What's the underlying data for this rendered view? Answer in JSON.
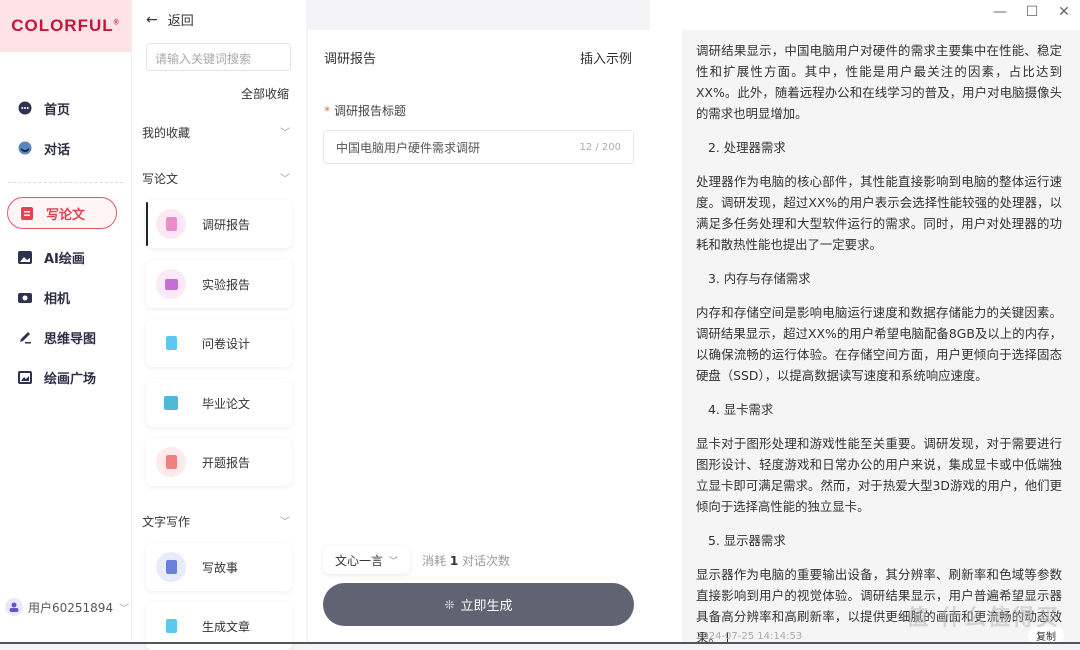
{
  "brand": {
    "logo": "COLORFUL",
    "accent": "#c2173a"
  },
  "nav": {
    "items": [
      {
        "label": "首页",
        "icon": "chat-bubble-icon"
      },
      {
        "label": "对话",
        "icon": "robot-icon"
      },
      {
        "label": "写论文",
        "icon": "document-icon",
        "active": true
      },
      {
        "label": "AI绘画",
        "icon": "image-icon"
      },
      {
        "label": "相机",
        "icon": "camera-icon"
      },
      {
        "label": "思维导图",
        "icon": "pen-icon"
      },
      {
        "label": "绘画广场",
        "icon": "gallery-icon"
      }
    ],
    "user": "用户60251894"
  },
  "templates": {
    "back": "返回",
    "search_placeholder": "请输入关键词搜索",
    "collapse_all": "全部收缩",
    "groups": [
      {
        "title": "我的收藏"
      },
      {
        "title": "写论文",
        "cards": [
          "调研报告",
          "实验报告",
          "问卷设计",
          "毕业论文",
          "开题报告"
        ]
      },
      {
        "title": "文字写作",
        "cards": [
          "写故事",
          "生成文章"
        ]
      }
    ]
  },
  "form": {
    "title": "调研报告",
    "insert_example": "插入示例",
    "field_label": "调研报告标题",
    "field_value": "中国电脑用户硬件需求调研",
    "field_count": "12 / 200",
    "model": "文心一言",
    "cost_prefix": "消耗",
    "cost_num": "1",
    "cost_suffix": "对话次数",
    "generate": "立即生成"
  },
  "output": {
    "p1": "调研结果显示，中国电脑用户对硬件的需求主要集中在性能、稳定性和扩展性方面。其中，性能是用户最关注的因素，占比达到XX%。此外，随着远程办公和在线学习的普及，用户对电脑摄像头的需求也明显增加。",
    "h2": "2. 处理器需求",
    "p2": "处理器作为电脑的核心部件，其性能直接影响到电脑的整体运行速度。调研发现，超过XX%的用户表示会选择性能较强的处理器，以满足多任务处理和大型软件运行的需求。同时，用户对处理器的功耗和散热性能也提出了一定要求。",
    "h3": "3. 内存与存储需求",
    "p3": "内存和存储空间是影响电脑运行速度和数据存储能力的关键因素。调研结果显示，超过XX%的用户希望电脑配备8GB及以上的内存，以确保流畅的运行体验。在存储空间方面，用户更倾向于选择固态硬盘（SSD），以提高数据读写速度和系统响应速度。",
    "h4": "4. 显卡需求",
    "p4": "显卡对于图形处理和游戏性能至关重要。调研发现，对于需要进行图形设计、轻度游戏和日常办公的用户来说，集成显卡或中低端独立显卡即可满足需求。然而，对于热爱大型3D游戏的用户，他们更倾向于选择高性能的独立显卡。",
    "h5": "5. 显示器需求",
    "p5": "显示器作为电脑的重要输出设备，其分辨率、刷新率和色域等参数直接影响到用户的视觉体验。调研结果显示，用户普遍希望显示器具备高分辨率和高刷新率，以提供更细腻的画面和更流畅的动态效果。",
    "timestamp": "2024-07-25 14:14:53",
    "copy": "复制",
    "watermark": "值 什么值得买"
  },
  "window": {
    "minimize": "—",
    "maximize": "☐",
    "close": "✕"
  }
}
